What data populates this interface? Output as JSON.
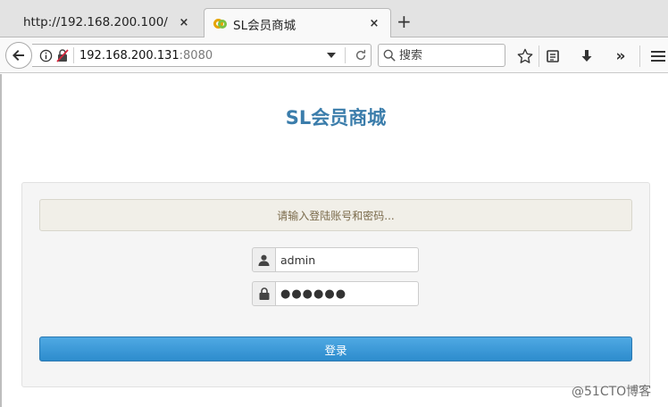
{
  "browser": {
    "tabs": [
      {
        "title": "http://192.168.200.100/",
        "close": "×",
        "active": false
      },
      {
        "title": "SL会员商城",
        "close": "×",
        "active": true
      }
    ],
    "new_tab": "+",
    "address": {
      "host": "192.168.200.131",
      "port": ":8080"
    },
    "search": {
      "placeholder": "搜索"
    },
    "overflow": "»"
  },
  "page": {
    "brand": "SL会员商城",
    "alert": "请输入登陆账号和密码...",
    "username": "admin",
    "password": "●●●●●●",
    "login_label": "登录"
  },
  "watermark": "@51CTO博客",
  "colors": {
    "brand": "#3b7dab",
    "button": "#2d8ccd",
    "alert_bg": "#f1efe8",
    "panel_bg": "#f5f5f5"
  }
}
